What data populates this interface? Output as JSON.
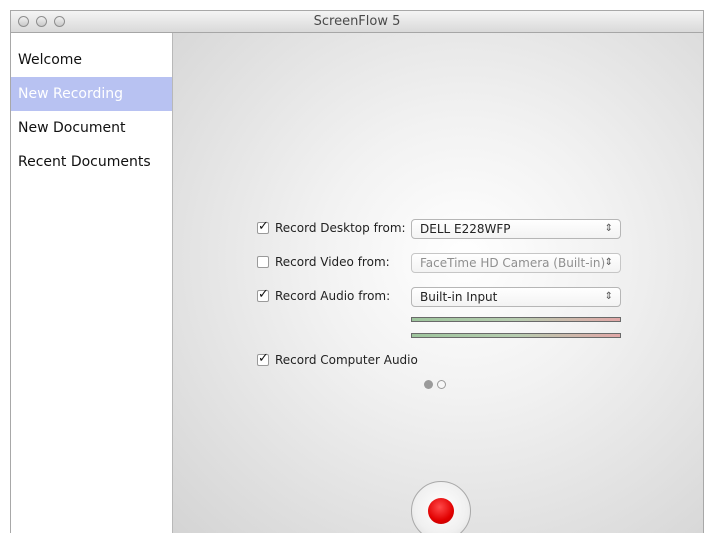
{
  "window": {
    "title": "ScreenFlow 5"
  },
  "sidebar": {
    "items": [
      {
        "label": "Welcome",
        "selected": false
      },
      {
        "label": "New Recording",
        "selected": true
      },
      {
        "label": "New Document",
        "selected": false
      },
      {
        "label": "Recent Documents",
        "selected": false
      }
    ]
  },
  "recording": {
    "desktop": {
      "label": "Record Desktop from:",
      "checked": true,
      "source": "DELL E228WFP"
    },
    "video": {
      "label": "Record Video from:",
      "checked": false,
      "source": "FaceTime HD Camera (Built-in)"
    },
    "audio": {
      "label": "Record Audio from:",
      "checked": true,
      "source": "Built-in Input"
    },
    "computer_audio": {
      "label": "Record Computer Audio",
      "checked": true
    }
  },
  "pager": {
    "pages": 2,
    "current": 1
  },
  "icons": {
    "record": "record-icon",
    "select_arrow": "updown-chevron-icon"
  },
  "colors": {
    "selection": "#b8c2f2",
    "record": "#e10000"
  }
}
